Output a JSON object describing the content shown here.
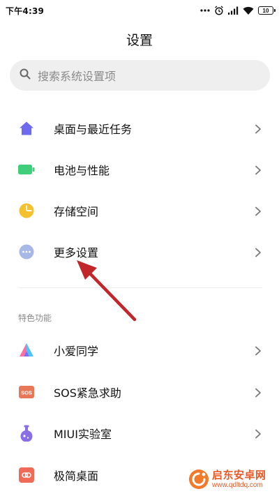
{
  "status_bar": {
    "time": "下午4:39",
    "battery": "10"
  },
  "header": {
    "title": "设置"
  },
  "search": {
    "placeholder": "搜索系统设置项"
  },
  "main_items": [
    {
      "label": "桌面与最近任务",
      "icon": "home-icon",
      "color": "#6e6af0"
    },
    {
      "label": "电池与性能",
      "icon": "battery-icon",
      "color": "#3fcf7b"
    },
    {
      "label": "存储空间",
      "icon": "pie-chart-icon",
      "color": "#f5c12e"
    },
    {
      "label": "更多设置",
      "icon": "more-dots-icon",
      "color": "#a8b8e6"
    }
  ],
  "section": {
    "header": "特色功能"
  },
  "feature_items": [
    {
      "label": "小爱同学",
      "icon": "xiaoai-icon",
      "color": "#6e6af0"
    },
    {
      "label": "SOS紧急求助",
      "icon": "sos-icon",
      "color": "#e8775a"
    },
    {
      "label": "MIUI实验室",
      "icon": "flask-icon",
      "color": "#8a6ee6"
    },
    {
      "label": "极简桌面",
      "icon": "minimal-desktop-icon",
      "color": "#ef6b58"
    }
  ],
  "annotation": {
    "arrow_color": "#c0262a"
  },
  "watermark": {
    "name": "启东安卓网",
    "url": "www.qdltdq.com"
  }
}
